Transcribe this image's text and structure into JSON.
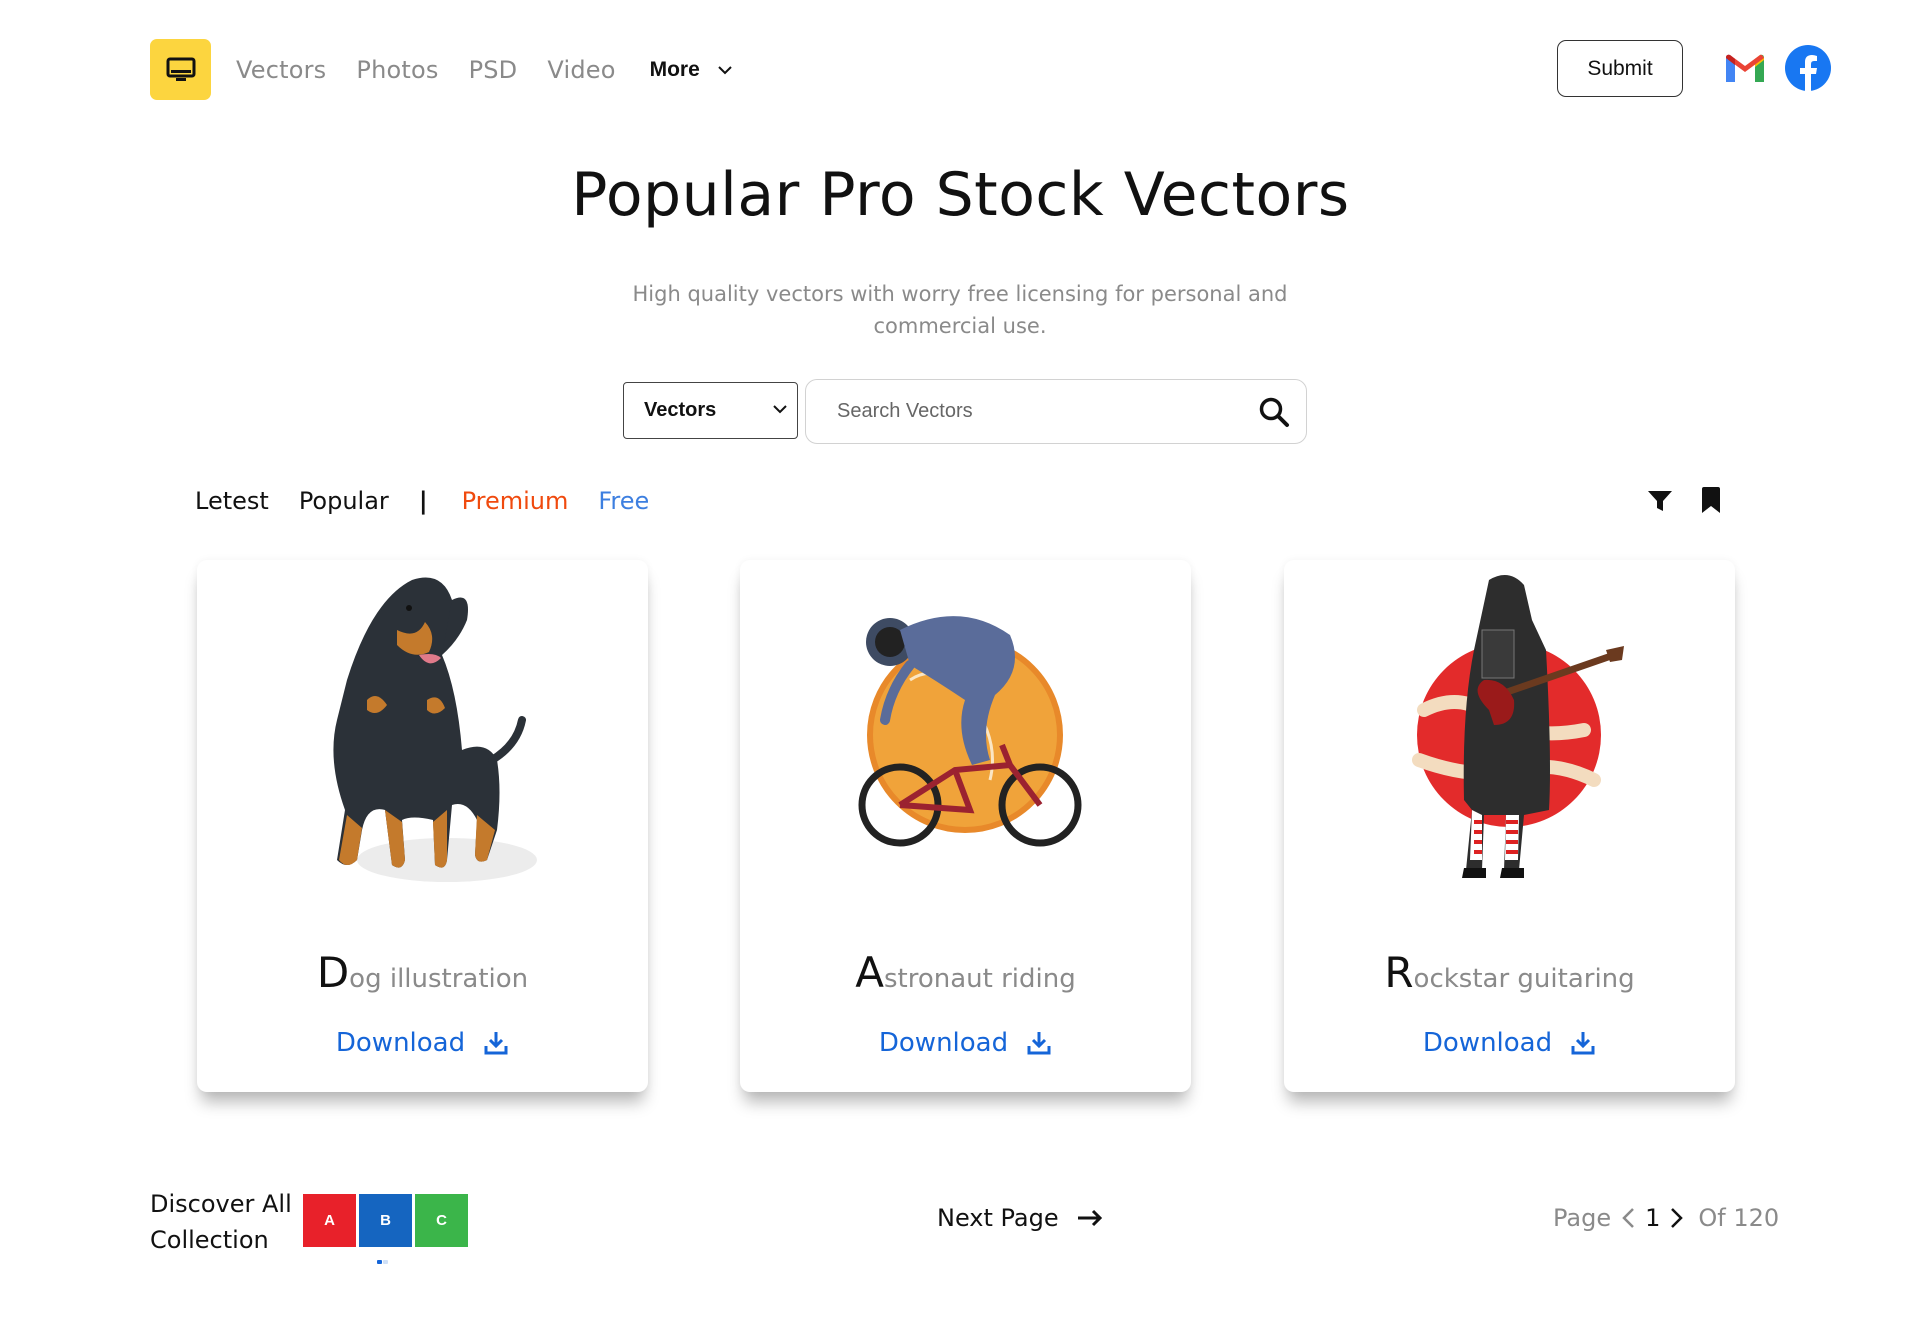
{
  "header": {
    "logo_icon": "monitor-icon",
    "nav": [
      {
        "label": "Vectors"
      },
      {
        "label": "Photos"
      },
      {
        "label": "PSD"
      },
      {
        "label": "Video"
      }
    ],
    "more_label": "More",
    "submit_label": "Submit",
    "social": [
      "gmail-icon",
      "facebook-icon"
    ]
  },
  "hero": {
    "title": "Popular Pro Stock Vectors",
    "subtitle": "High quality vectors with worry free licensing for personal and commercial use."
  },
  "search": {
    "category_value": "Vectors",
    "placeholder": "Search Vectors"
  },
  "tabs": {
    "latest": "Letest",
    "popular": "Popular",
    "separator": "|",
    "premium": "Premium",
    "free": "Free"
  },
  "cards": [
    {
      "initial": "D",
      "rest": "og illustration",
      "download": "Download",
      "art": "rottweiler-dog"
    },
    {
      "initial": "A",
      "rest": "stronaut riding",
      "download": "Download",
      "art": "astronaut-bmx"
    },
    {
      "initial": "R",
      "rest": "ockstar guitaring",
      "download": "Download",
      "art": "rockstar-guitar"
    }
  ],
  "footer": {
    "discover_line1": "Discover All",
    "discover_line2": "Collection",
    "abc": [
      {
        "letter": "A",
        "color": "#e8212a"
      },
      {
        "letter": "B",
        "color": "#1565c0"
      },
      {
        "letter": "C",
        "color": "#3bb54a"
      }
    ],
    "next_page": "Next Page",
    "page_label": "Page",
    "page_current": "1",
    "page_of": "Of 120"
  },
  "colors": {
    "accent_yellow": "#fcd53f",
    "premium": "#f04a0e",
    "free": "#3d7fe0",
    "download": "#1565d8"
  }
}
